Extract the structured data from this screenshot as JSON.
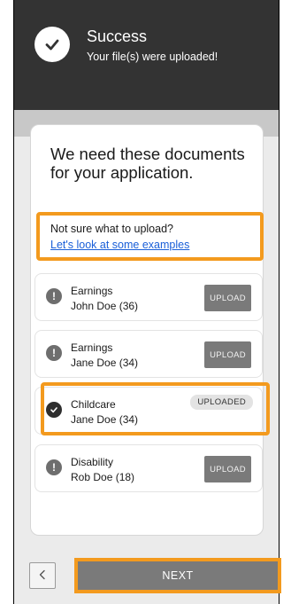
{
  "toast": {
    "title": "Success",
    "message": "Your file(s) were uploaded!",
    "icon": "check-icon"
  },
  "card": {
    "title": "We need these documents for your application."
  },
  "help": {
    "question": "Not sure what to upload?",
    "link": "Let's look at some examples"
  },
  "documents": [
    {
      "name": "Earnings",
      "person": "John Doe (36)",
      "status_icon": "warning-icon",
      "action": "UPLOAD"
    },
    {
      "name": "Earnings",
      "person": "Jane Doe (34)",
      "status_icon": "warning-icon",
      "action": "UPLOAD"
    },
    {
      "name": "Childcare",
      "person": "Jane Doe (34)",
      "status_icon": "check-icon",
      "badge": "UPLOADED"
    },
    {
      "name": "Disability",
      "person": "Rob Doe (18)",
      "status_icon": "warning-icon",
      "action": "UPLOAD"
    }
  ],
  "footer": {
    "back_icon": "chevron-left-icon",
    "next_label": "NEXT"
  },
  "colors": {
    "highlight": "#f39a1e",
    "toast_bg": "#333333",
    "link": "#1a5fd8",
    "button_bg": "#7a7a7a"
  }
}
